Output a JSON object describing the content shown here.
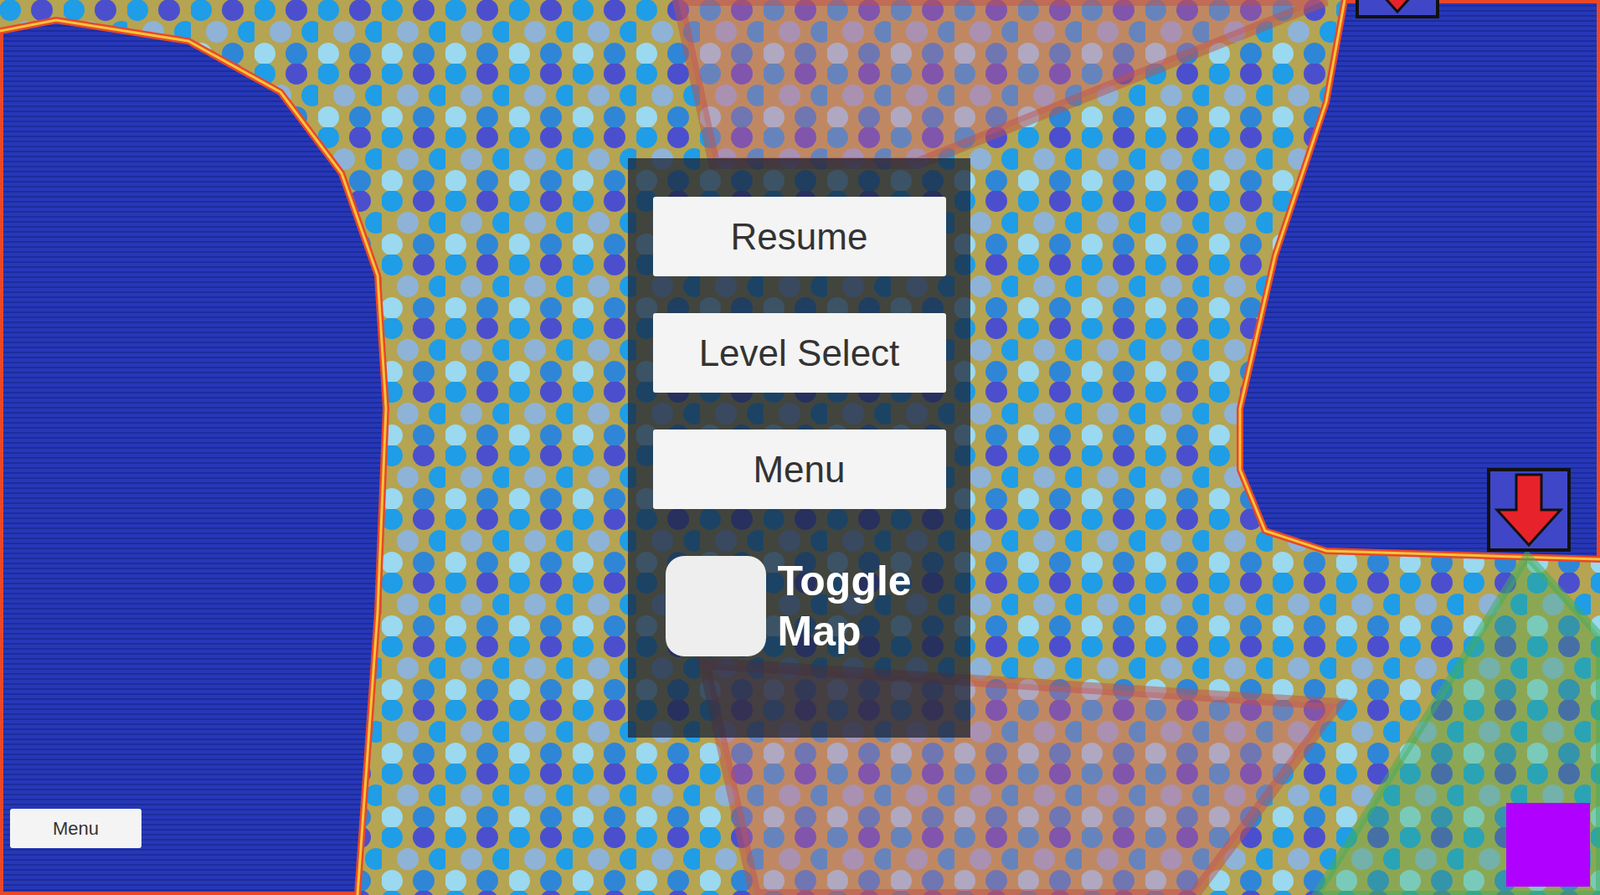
{
  "pause_menu": {
    "buttons": [
      "Resume",
      "Level Select",
      "Menu"
    ],
    "toggle": {
      "label": "Toggle Map",
      "checked": false
    }
  },
  "corner_button": "Menu"
}
